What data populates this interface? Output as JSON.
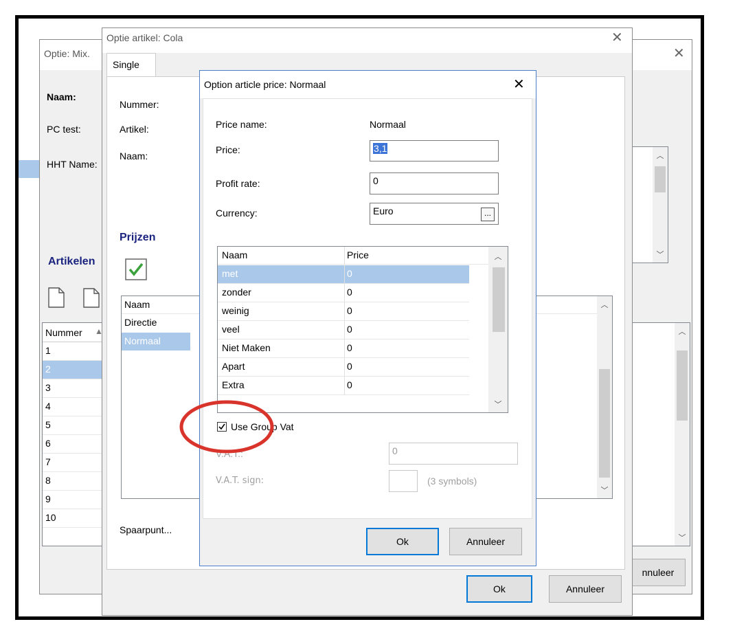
{
  "back_window": {
    "title": "Optie: Mix.",
    "labels": {
      "naam": "Naam:",
      "pc_test": "PC test:",
      "hht_name": "HHT Name:"
    },
    "artikelen_heading": "Artikelen",
    "table": {
      "column_header": "Nummer",
      "rows": [
        "1",
        "2",
        "3",
        "4",
        "5",
        "6",
        "7",
        "8",
        "9",
        "10"
      ],
      "selected_index": 1
    },
    "cancel_label": "nnuleer"
  },
  "mid_window": {
    "title": "Optie artikel: Cola",
    "tab_label": "Single",
    "labels": {
      "nummer": "Nummer:",
      "artikel": "Artikel:",
      "naam": "Naam:"
    },
    "prijzen_heading": "Prijzen",
    "price_list": {
      "column_header": "Naam",
      "rows": [
        "Directie",
        "Normaal"
      ],
      "selected_index": 1
    },
    "spaarpunt_label": "Spaarpunt...",
    "ok_label": "Ok",
    "cancel_label": "Annuleer"
  },
  "dialog": {
    "title": "Option article price: Normaal",
    "price_name_label": "Price name:",
    "price_name_value": "Normaal",
    "price_label": "Price:",
    "price_value": "3,1",
    "profit_rate_label": "Profit rate:",
    "profit_rate_value": "0",
    "currency_label": "Currency:",
    "currency_value": "Euro",
    "currency_browse": "...",
    "table": {
      "columns": [
        "Naam",
        "Price"
      ],
      "rows": [
        [
          "met",
          "0"
        ],
        [
          "zonder",
          "0"
        ],
        [
          "weinig",
          "0"
        ],
        [
          "veel",
          "0"
        ],
        [
          "Niet Maken",
          "0"
        ],
        [
          "Apart",
          "0"
        ],
        [
          "Extra",
          "0"
        ]
      ],
      "selected_index": 0
    },
    "use_group_vat_label": "Use Group Vat",
    "use_group_vat_checked": true,
    "vat_label": "V.A.T.:",
    "vat_value": "0",
    "vat_sign_label": "V.A.T. sign:",
    "vat_sign_value": "",
    "vat_sign_hint": "(3 symbols)",
    "ok_label": "Ok",
    "cancel_label": "Annuleer"
  },
  "colors": {
    "accent": "#0078d7",
    "selection": "#aac8ea",
    "annotation": "#d9342b",
    "heading": "#1a237e"
  }
}
